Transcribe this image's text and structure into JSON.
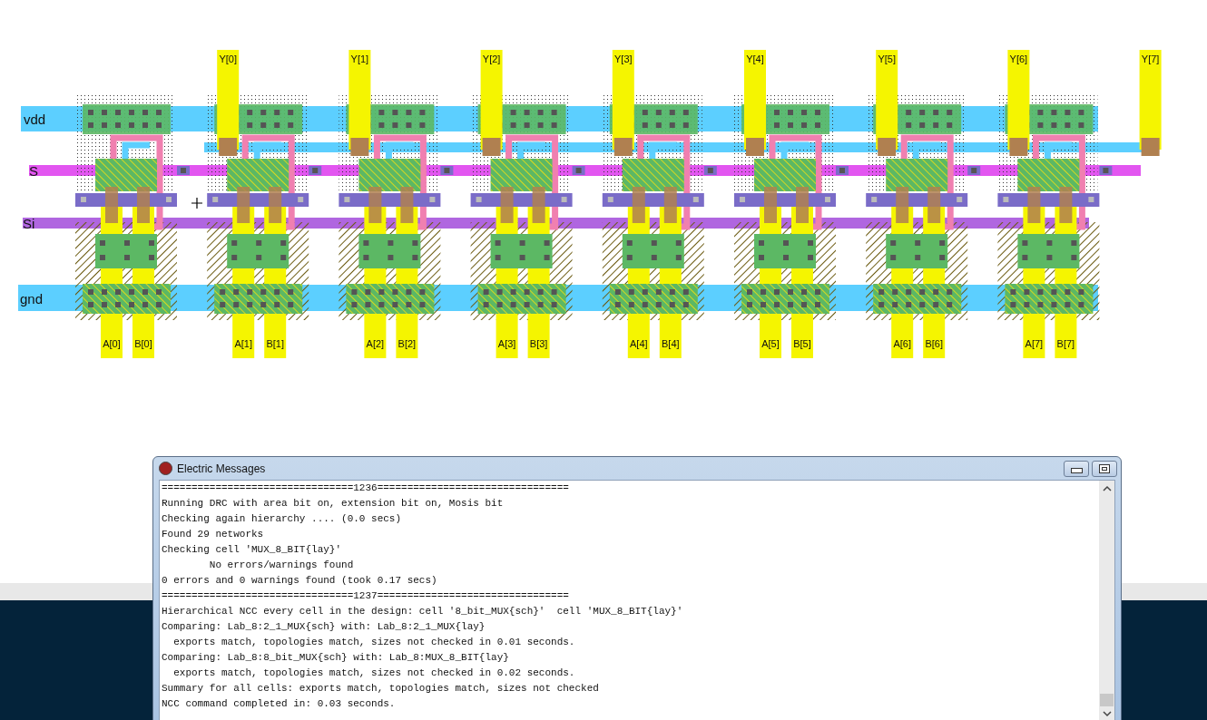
{
  "layout": {
    "rails": [
      {
        "kind": "vdd",
        "label": "vdd"
      },
      {
        "kind": "s",
        "label": "S"
      },
      {
        "kind": "si",
        "label": "Si"
      },
      {
        "kind": "gnd",
        "label": "gnd"
      }
    ],
    "outputs": [
      "Y[0]",
      "Y[1]",
      "Y[2]",
      "Y[3]",
      "Y[4]",
      "Y[5]",
      "Y[6]",
      "Y[7]"
    ],
    "inputs": [
      {
        "a": "A[0]",
        "b": "B[0]"
      },
      {
        "a": "A[1]",
        "b": "B[1]"
      },
      {
        "a": "A[2]",
        "b": "B[2]"
      },
      {
        "a": "A[3]",
        "b": "B[3]"
      },
      {
        "a": "A[4]",
        "b": "B[4]"
      },
      {
        "a": "A[5]",
        "b": "B[5]"
      },
      {
        "a": "A[6]",
        "b": "B[6]"
      },
      {
        "a": "A[7]",
        "b": "B[7]"
      }
    ]
  },
  "messages_window": {
    "title": "Electric Messages",
    "lines": [
      "================================1236================================",
      "Running DRC with area bit on, extension bit on, Mosis bit",
      "Checking again hierarchy .... (0.0 secs)",
      "Found 29 networks",
      "Checking cell 'MUX_8_BIT{lay}'",
      "        No errors/warnings found",
      "0 errors and 0 warnings found (took 0.17 secs)",
      "================================1237================================",
      "Hierarchical NCC every cell in the design: cell '8_bit_MUX{sch}'  cell 'MUX_8_BIT{lay}'",
      "Comparing: Lab_8:2_1_MUX{sch} with: Lab_8:2_1_MUX{lay}",
      "  exports match, topologies match, sizes not checked in 0.01 seconds.",
      "Comparing: Lab_8:8_bit_MUX{sch} with: Lab_8:MUX_8_BIT{lay}",
      "  exports match, topologies match, sizes not checked in 0.02 seconds.",
      "Summary for all cells: exports match, topologies match, sizes not checked",
      "NCC command completed in: 0.03 seconds."
    ]
  }
}
